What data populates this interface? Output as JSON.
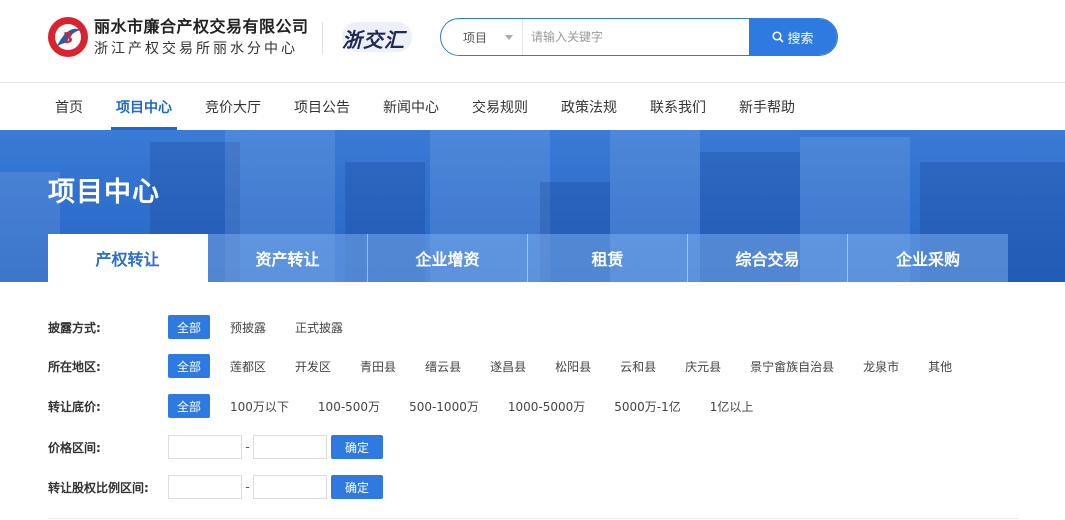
{
  "header": {
    "company_line1": "丽水市廉合产权交易有限公司",
    "company_line2": "浙江产权交易所丽水分中心",
    "brand2": "浙交汇",
    "search": {
      "category": "项目",
      "placeholder": "请输入关键字",
      "button": "搜索"
    }
  },
  "nav": [
    "首页",
    "项目中心",
    "竞价大厅",
    "项目公告",
    "新闻中心",
    "交易规则",
    "政策法规",
    "联系我们",
    "新手帮助"
  ],
  "nav_active": 1,
  "banner": {
    "title": "项目中心"
  },
  "tabs": [
    "产权转让",
    "资产转让",
    "企业增资",
    "租赁",
    "综合交易",
    "企业采购"
  ],
  "tabs_active": 0,
  "filters": {
    "disclosure": {
      "label": "披露方式:",
      "options": [
        "全部",
        "预披露",
        "正式披露"
      ]
    },
    "region": {
      "label": "所在地区:",
      "options": [
        "全部",
        "莲都区",
        "开发区",
        "青田县",
        "缙云县",
        "遂昌县",
        "松阳县",
        "云和县",
        "庆元县",
        "景宁畲族自治县",
        "龙泉市",
        "其他"
      ]
    },
    "price": {
      "label": "转让底价:",
      "options": [
        "全部",
        "100万以下",
        "100-500万",
        "500-1000万",
        "1000-5000万",
        "5000万-1亿",
        "1亿以上"
      ]
    },
    "price_range": {
      "label": "价格区间:",
      "dash": "-",
      "confirm": "确定"
    },
    "ratio_range": {
      "label": "转让股权比例区间:",
      "dash": "-",
      "confirm": "确定"
    }
  },
  "colors": {
    "primary": "#2e7ae0",
    "nav_active": "#1f68c9",
    "logo_red": "#d9232e",
    "logo_blue": "#1f5fb5"
  }
}
